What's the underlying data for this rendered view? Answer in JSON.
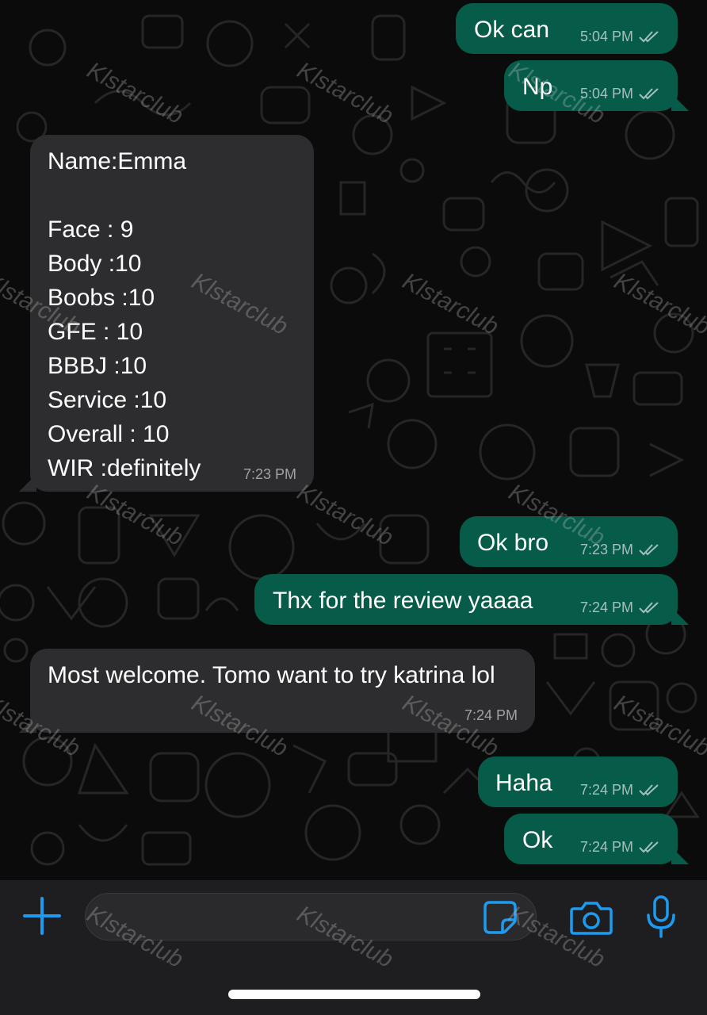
{
  "colors": {
    "outgoing_bubble": "#075c49",
    "incoming_bubble": "#2d2d2f",
    "accent": "#1d9bf0"
  },
  "watermark_text": "Klstarclub",
  "messages": [
    {
      "direction": "out",
      "text": "Ok can",
      "time": "5:04 PM",
      "read": true
    },
    {
      "direction": "out",
      "text": "Np",
      "time": "5:04 PM",
      "read": true
    },
    {
      "direction": "in",
      "text": "Name:Emma\n\nFace : 9\nBody :10\nBoobs :10\nGFE : 10\nBBBJ :10\nService :10\nOverall : 10\nWIR :definitely",
      "time": "7:23 PM"
    },
    {
      "direction": "out",
      "text": "Ok bro",
      "time": "7:23 PM",
      "read": true
    },
    {
      "direction": "out",
      "text": "Thx for the review yaaaa",
      "time": "7:24 PM",
      "read": true
    },
    {
      "direction": "in",
      "text": "Most welcome. Tomo want to try katrina lol",
      "time": "7:24 PM"
    },
    {
      "direction": "out",
      "text": "Haha",
      "time": "7:24 PM",
      "read": true
    },
    {
      "direction": "out",
      "text": "Ok",
      "time": "7:24 PM",
      "read": true
    }
  ],
  "input_bar": {
    "attach_icon": "plus-icon",
    "placeholder": "",
    "sticker_icon": "sticker-icon",
    "camera_icon": "camera-icon",
    "mic_icon": "microphone-icon"
  }
}
